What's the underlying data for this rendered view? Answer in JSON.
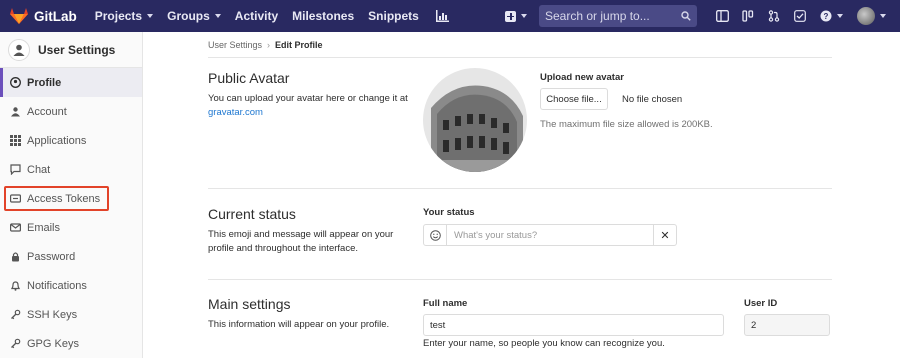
{
  "navbar": {
    "brand": "GitLab",
    "links": [
      {
        "label": "Projects",
        "caret": true
      },
      {
        "label": "Groups",
        "caret": true
      },
      {
        "label": "Activity",
        "caret": false
      },
      {
        "label": "Milestones",
        "caret": false
      },
      {
        "label": "Snippets",
        "caret": false
      }
    ],
    "search_placeholder": "Search or jump to...",
    "colors": {
      "bg": "#292961",
      "accent": "#e24329"
    }
  },
  "sidebar": {
    "title": "User Settings",
    "items": [
      {
        "label": "Profile",
        "icon": "profile-icon",
        "active": true
      },
      {
        "label": "Account",
        "icon": "account-icon"
      },
      {
        "label": "Applications",
        "icon": "applications-icon"
      },
      {
        "label": "Chat",
        "icon": "chat-icon"
      },
      {
        "label": "Access Tokens",
        "icon": "token-icon",
        "highlighted": true
      },
      {
        "label": "Emails",
        "icon": "email-icon"
      },
      {
        "label": "Password",
        "icon": "lock-icon"
      },
      {
        "label": "Notifications",
        "icon": "bell-icon"
      },
      {
        "label": "SSH Keys",
        "icon": "key-icon"
      },
      {
        "label": "GPG Keys",
        "icon": "key-icon"
      }
    ]
  },
  "breadcrumb": {
    "parent": "User Settings",
    "current": "Edit Profile"
  },
  "avatar_section": {
    "title": "Public Avatar",
    "desc_prefix": "You can upload your avatar here or change it at",
    "link": "gravatar.com",
    "upload_label": "Upload new avatar",
    "choose_button": "Choose file...",
    "no_file": "No file chosen",
    "max_size": "The maximum file size allowed is 200KB."
  },
  "status_section": {
    "title": "Current status",
    "desc": "This emoji and message will appear on your profile and throughout the interface.",
    "field_label": "Your status",
    "placeholder": "What's your status?"
  },
  "main_section": {
    "title": "Main settings",
    "desc": "This information will appear on your profile.",
    "full_name_label": "Full name",
    "full_name_value": "test",
    "full_name_help": "Enter your name, so people you know can recognize you.",
    "user_id_label": "User ID",
    "user_id_value": "2"
  }
}
